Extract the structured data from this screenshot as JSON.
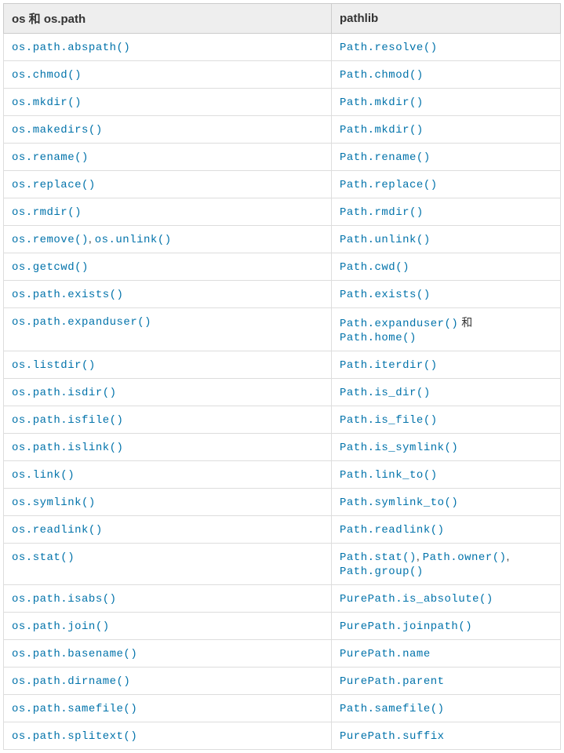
{
  "headers": {
    "left": "os 和 os.path",
    "right": "pathlib"
  },
  "sep": ", ",
  "conj": " 和 ",
  "rows": [
    {
      "left": [
        "os.path.abspath()"
      ],
      "right": [
        "Path.resolve()"
      ]
    },
    {
      "left": [
        "os.chmod()"
      ],
      "right": [
        "Path.chmod()"
      ]
    },
    {
      "left": [
        "os.mkdir()"
      ],
      "right": [
        "Path.mkdir()"
      ]
    },
    {
      "left": [
        "os.makedirs()"
      ],
      "right": [
        "Path.mkdir()"
      ]
    },
    {
      "left": [
        "os.rename()"
      ],
      "right": [
        "Path.rename()"
      ]
    },
    {
      "left": [
        "os.replace()"
      ],
      "right": [
        "Path.replace()"
      ]
    },
    {
      "left": [
        "os.rmdir()"
      ],
      "right": [
        "Path.rmdir()"
      ]
    },
    {
      "left": [
        "os.remove()",
        "os.unlink()"
      ],
      "leftJoin": "sep",
      "right": [
        "Path.unlink()"
      ]
    },
    {
      "left": [
        "os.getcwd()"
      ],
      "right": [
        "Path.cwd()"
      ]
    },
    {
      "left": [
        "os.path.exists()"
      ],
      "right": [
        "Path.exists()"
      ]
    },
    {
      "left": [
        "os.path.expanduser()"
      ],
      "right": [
        "Path.expanduser()",
        "Path.home()"
      ],
      "rightJoin": "conj"
    },
    {
      "left": [
        "os.listdir()"
      ],
      "right": [
        "Path.iterdir()"
      ]
    },
    {
      "left": [
        "os.path.isdir()"
      ],
      "right": [
        "Path.is_dir()"
      ]
    },
    {
      "left": [
        "os.path.isfile()"
      ],
      "right": [
        "Path.is_file()"
      ]
    },
    {
      "left": [
        "os.path.islink()"
      ],
      "right": [
        "Path.is_symlink()"
      ]
    },
    {
      "left": [
        "os.link()"
      ],
      "right": [
        "Path.link_to()"
      ]
    },
    {
      "left": [
        "os.symlink()"
      ],
      "right": [
        "Path.symlink_to()"
      ]
    },
    {
      "left": [
        "os.readlink()"
      ],
      "right": [
        "Path.readlink()"
      ]
    },
    {
      "left": [
        "os.stat()"
      ],
      "right": [
        "Path.stat()",
        "Path.owner()",
        "Path.group()"
      ],
      "rightJoin": "sep",
      "rightBreakAfter": 1
    },
    {
      "left": [
        "os.path.isabs()"
      ],
      "right": [
        "PurePath.is_absolute()"
      ]
    },
    {
      "left": [
        "os.path.join()"
      ],
      "right": [
        "PurePath.joinpath()"
      ]
    },
    {
      "left": [
        "os.path.basename()"
      ],
      "right": [
        "PurePath.name"
      ]
    },
    {
      "left": [
        "os.path.dirname()"
      ],
      "right": [
        "PurePath.parent"
      ]
    },
    {
      "left": [
        "os.path.samefile()"
      ],
      "right": [
        "Path.samefile()"
      ]
    },
    {
      "left": [
        "os.path.splitext()"
      ],
      "right": [
        "PurePath.suffix"
      ]
    }
  ]
}
